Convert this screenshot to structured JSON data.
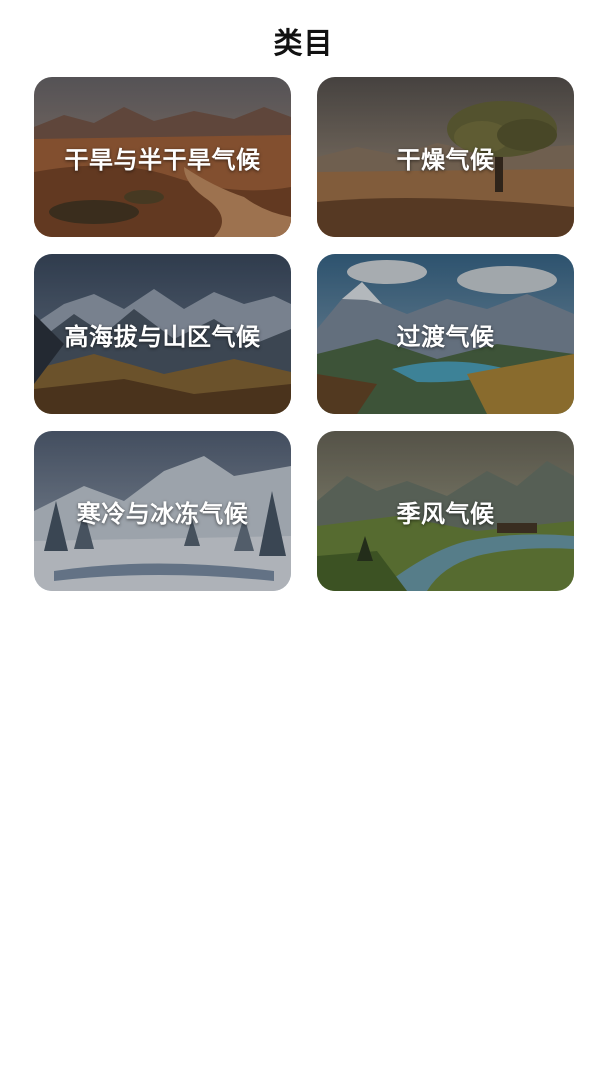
{
  "header": {
    "title": "类目"
  },
  "categories": [
    {
      "label": "干旱与半干旱气候",
      "image": "arid-desert-landscape"
    },
    {
      "label": "干燥气候",
      "image": "dry-savanna-tree-landscape"
    },
    {
      "label": "高海拔与山区气候",
      "image": "high-mountain-landscape"
    },
    {
      "label": "过渡气候",
      "image": "mountain-lake-landscape"
    },
    {
      "label": "寒冷与冰冻气候",
      "image": "snowy-forest-landscape"
    },
    {
      "label": "季风气候",
      "image": "monsoon-river-valley-landscape"
    }
  ]
}
